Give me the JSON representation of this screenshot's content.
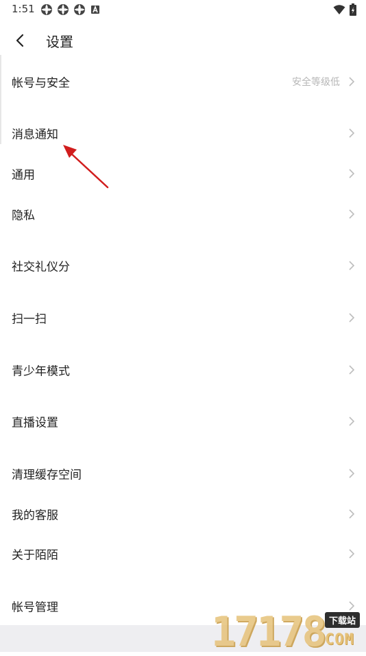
{
  "status_bar": {
    "time": "1:51",
    "notification_icons": [
      "app-icon",
      "app-icon",
      "app-icon",
      "a-icon"
    ],
    "right_icons": [
      "wifi-icon",
      "battery-icon"
    ]
  },
  "header": {
    "title": "设置"
  },
  "settings": {
    "items": [
      {
        "label": "帐号与安全",
        "value": "安全等级低"
      },
      {
        "label": "消息通知",
        "value": ""
      },
      {
        "label": "通用",
        "value": ""
      },
      {
        "label": "隐私",
        "value": ""
      },
      {
        "label": "社交礼仪分",
        "value": ""
      },
      {
        "label": "扫一扫",
        "value": ""
      },
      {
        "label": "青少年模式",
        "value": ""
      },
      {
        "label": "直播设置",
        "value": ""
      },
      {
        "label": "清理缓存空间",
        "value": ""
      },
      {
        "label": "我的客服",
        "value": ""
      },
      {
        "label": "关于陌陌",
        "value": ""
      },
      {
        "label": "帐号管理",
        "value": ""
      }
    ]
  },
  "watermark": {
    "digits": "17178",
    "tag": "下载站",
    "suffix": "COM"
  },
  "colors": {
    "annotation_arrow": "#d11d1d",
    "watermark": "#e6c27a"
  }
}
